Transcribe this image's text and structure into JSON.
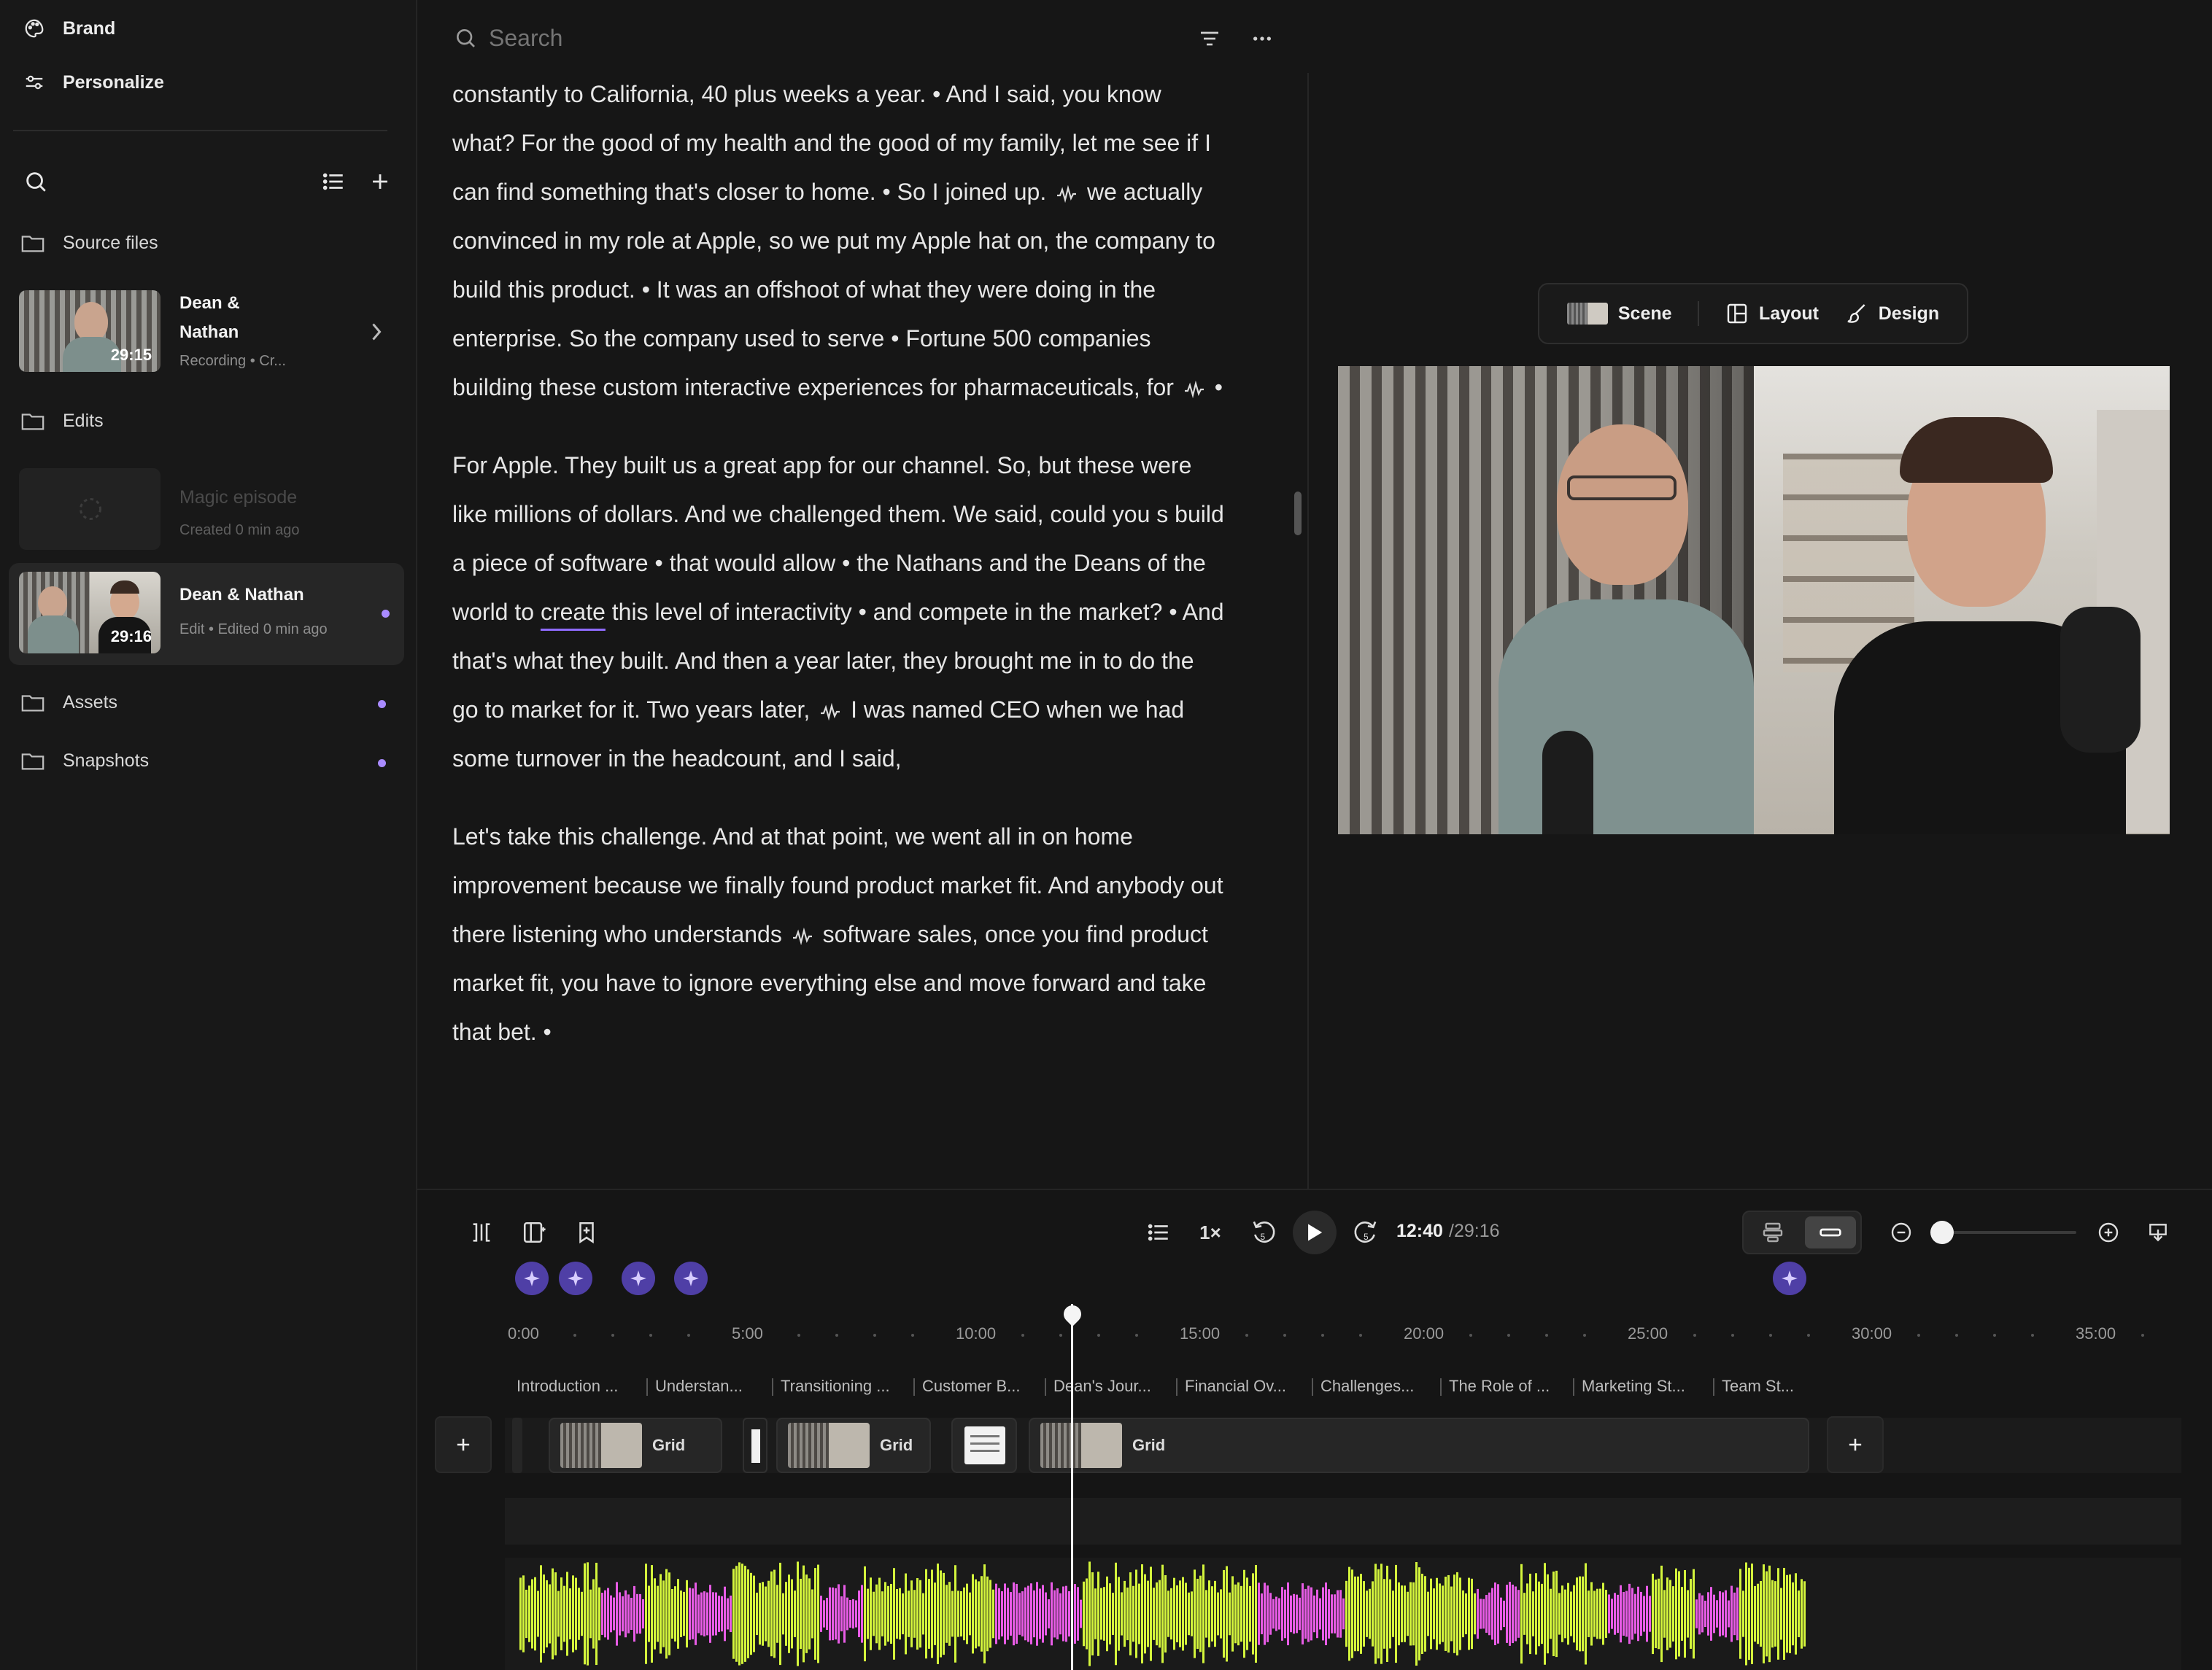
{
  "sidebar": {
    "top_items": [
      {
        "label": "Brand",
        "icon": "palette-icon"
      },
      {
        "label": "Personalize",
        "icon": "sliders-icon"
      }
    ],
    "folders": {
      "source_files": "Source files",
      "edits": "Edits",
      "assets": "Assets",
      "snapshots": "Snapshots"
    },
    "recording_card": {
      "title_line1": "Dean &",
      "title_line2": "Nathan",
      "subtitle": "Recording • Cr...",
      "duration": "29:15"
    },
    "magic_card": {
      "title": "Magic episode",
      "subtitle": "Created 0 min ago"
    },
    "edit_card": {
      "title": "Dean & Nathan",
      "subtitle": "Edit • Edited 0 min ago",
      "duration": "29:16"
    },
    "accent": "#a98bff"
  },
  "search": {
    "placeholder": "Search"
  },
  "transcript": {
    "p1": {
      "a": "constantly to California, 40 plus weeks a year. • And I said, you know what? For the good of my health and the good of my family, let me see if I can find something that's closer to home. • So I joined up.",
      "b": "we actually convinced in my role at Apple, so we put my Apple hat on, the company to build this product. • It was an offshoot of what they were doing in the enterprise. So the company used to serve • Fortune 500 companies building these custom interactive experiences for pharmaceuticals, for",
      "c": "•"
    },
    "p2": {
      "a": "For Apple. They built us a great app for our channel. So, but these were like millions of dollars. And we challenged them. We said, could you s build a piece of software • that would allow • the Nathans and the Deans of the world to",
      "underlined": "create",
      "b": "this level of interactivity • and compete in the market? • And that's what they built. And then a year later, they brought me in to do the go to market for it. Two years later,",
      "c": "I was named CEO when we had some turnover in the headcount, and I said,"
    },
    "p3": {
      "a": "Let's take this challenge. And at that point, we went all in on home improvement because we finally found product market fit. And anybody out there listening who understands",
      "b": "software sales, once you find product market fit, you have to ignore everything else and move forward and take that bet. •"
    }
  },
  "scene_toolbar": {
    "scene": "Scene",
    "layout": "Layout",
    "design": "Design"
  },
  "player": {
    "speed": "1×",
    "current_time": "12:40",
    "total_time": "/29:16",
    "zoom_level": 0.0
  },
  "timeline": {
    "ticks": [
      "0:00",
      "5:00",
      "10:00",
      "15:00",
      "20:00",
      "25:00",
      "30:00",
      "35:00"
    ],
    "chapters": [
      "Introduction ...",
      "Understan...",
      "Transitioning ...",
      "Customer B...",
      "Dean's Jour...",
      "Financial Ov...",
      "Challenges...",
      "The Role of ...",
      "Marketing St...",
      "Team St..."
    ],
    "clips": [
      "Grid",
      "Grid",
      "Grid"
    ],
    "playhead_time": "12:40"
  }
}
